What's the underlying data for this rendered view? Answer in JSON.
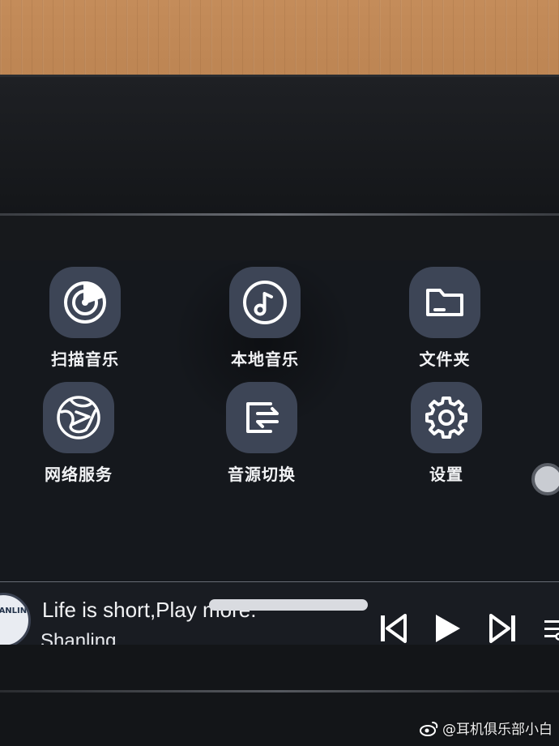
{
  "apps": [
    {
      "label": "扫描音乐",
      "icon": "scan-radar-icon"
    },
    {
      "label": "本地音乐",
      "icon": "music-note-icon"
    },
    {
      "label": "文件夹",
      "icon": "folder-icon"
    },
    {
      "label": "网络服务",
      "icon": "globe-network-icon"
    },
    {
      "label": "音源切换",
      "icon": "source-switch-icon"
    },
    {
      "label": "设置",
      "icon": "gear-icon"
    }
  ],
  "player": {
    "title": "Life is short,Play more.",
    "artist": "Shanling",
    "album_logo": "SHANLING"
  },
  "watermark": "@耳机俱乐部小白",
  "colors": {
    "icon_tile": "#3d4556",
    "screen_bg": "#15181d",
    "text": "#f2f3f5"
  }
}
